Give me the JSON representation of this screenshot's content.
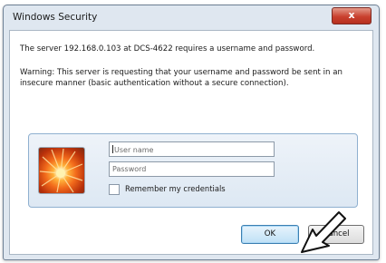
{
  "window": {
    "title": "Windows Security",
    "close_glyph": "x"
  },
  "message": {
    "line1": "The server 192.168.0.103 at DCS-4622 requires a username and password.",
    "warning": "Warning: This server is requesting that your username and password be sent in an insecure manner (basic authentication without a secure connection)."
  },
  "credentials": {
    "username_placeholder": "User name",
    "password_placeholder": "Password",
    "remember_label": "Remember my credentials",
    "remember_checked": false,
    "avatar_icon": "user-tile-flower-icon"
  },
  "buttons": {
    "ok_label": "OK",
    "cancel_label": "Cancel"
  },
  "annotation": {
    "pointer_icon": "pointing-arrow-icon"
  },
  "colors": {
    "frame": "#dfe7f0",
    "close_button": "#c9412f",
    "panel_border": "#8fb0d0",
    "default_button": "#3c7fb1"
  }
}
